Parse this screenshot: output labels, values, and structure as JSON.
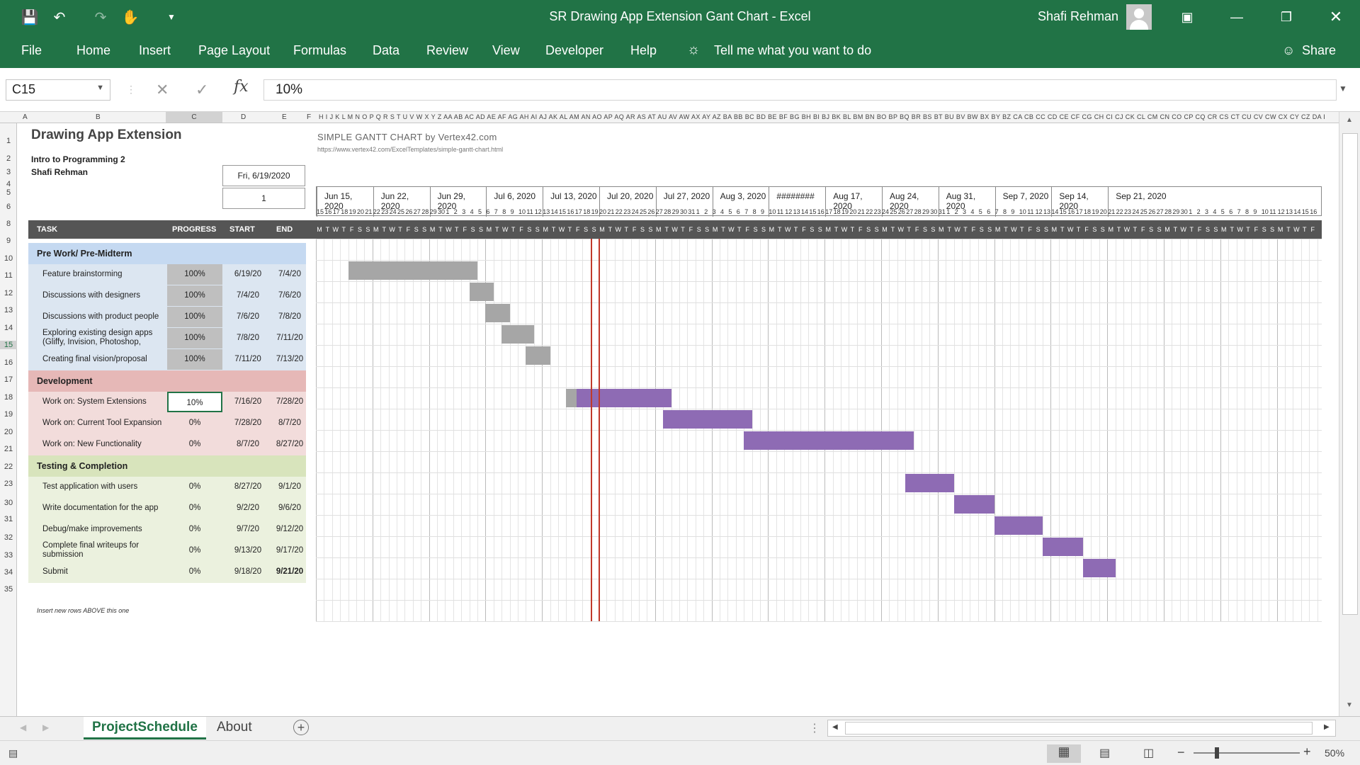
{
  "window": {
    "title": "SR Drawing App Extension Gant Chart  -  Excel",
    "user": "Shafi Rehman",
    "colors": {
      "ribbon": "#217346",
      "complete_bar": "#a6a6a6",
      "task_bar": "#8e6bb4",
      "today_line": "#c0392b"
    }
  },
  "qat": {
    "save_icon": "save-icon",
    "undo_icon": "undo-icon",
    "redo_icon": "redo-icon",
    "touch_icon": "touch-mode-icon",
    "customize_icon": "customize-qat-icon"
  },
  "ribbon": {
    "tabs": [
      "File",
      "Home",
      "Insert",
      "Page Layout",
      "Formulas",
      "Data",
      "Review",
      "View",
      "Developer",
      "Help"
    ],
    "tell_me": "Tell me what you want to do",
    "share": "Share"
  },
  "formula_bar": {
    "name_box": "C15",
    "value": "10%"
  },
  "columns": {
    "a": "A",
    "b": "B",
    "c": "C",
    "d": "D",
    "e": "E",
    "f": "F"
  },
  "rows": [
    "1",
    "2",
    "3",
    "4",
    "5",
    "6",
    "8",
    "9",
    "10",
    "11",
    "12",
    "13",
    "14",
    "15",
    "16",
    "17",
    "18",
    "19",
    "20",
    "21",
    "22",
    "23",
    "30",
    "31",
    "32",
    "33",
    "34",
    "35"
  ],
  "sheet": {
    "title": "Drawing App Extension",
    "subtitle": "Intro to Programming 2",
    "author": "Shafi Rehman",
    "project_start": "Fri, 6/19/2020",
    "display_week": "1",
    "template_title": "SIMPLE GANTT CHART by Vertex42.com",
    "template_url": "https://www.vertex42.com/ExcelTemplates/simple-gantt-chart.html",
    "headers": {
      "task": "TASK",
      "progress": "PROGRESS",
      "start": "START",
      "end": "END"
    },
    "weeks": [
      "Jun 15, 2020",
      "Jun 22, 2020",
      "Jun 29, 2020",
      "Jul 6, 2020",
      "Jul 13, 2020",
      "Jul 20, 2020",
      "Jul 27, 2020",
      "Aug 3, 2020",
      "########",
      "Aug 17, 2020",
      "Aug 24, 2020",
      "Aug 31, 2020",
      "Sep 7, 2020",
      "Sep 14, 2020",
      "Sep 21, 2020"
    ],
    "dow": [
      "M",
      "T",
      "W",
      "T",
      "F",
      "S",
      "S"
    ],
    "insert_note": "Insert new rows ABOVE this one"
  },
  "phases": [
    {
      "label": "Pre Work/ Pre-Midterm",
      "color": "#c5d9f1",
      "row_color": "#dce6f1",
      "tasks": [
        {
          "name": "Feature brainstorming",
          "progress": "100%",
          "start": "6/19/20",
          "end": "7/4/20"
        },
        {
          "name": "Discussions with designers",
          "progress": "100%",
          "start": "7/4/20",
          "end": "7/6/20"
        },
        {
          "name": "Discussions with product people",
          "progress": "100%",
          "start": "7/6/20",
          "end": "7/8/20"
        },
        {
          "name": "Exploring existing design apps (Gliffy, Invision, Photoshop,",
          "progress": "100%",
          "start": "7/8/20",
          "end": "7/11/20"
        },
        {
          "name": "Creating final vision/proposal",
          "progress": "100%",
          "start": "7/11/20",
          "end": "7/13/20"
        }
      ]
    },
    {
      "label": "Development",
      "color": "#e6b8b7",
      "row_color": "#f2dcdb",
      "tasks": [
        {
          "name": "Work on: System Extensions",
          "progress": "10%",
          "start": "7/16/20",
          "end": "7/28/20"
        },
        {
          "name": "Work on: Current Tool Expansion",
          "progress": "0%",
          "start": "7/28/20",
          "end": "8/7/20"
        },
        {
          "name": "Work on:  New Functionality",
          "progress": "0%",
          "start": "8/7/20",
          "end": "8/27/20"
        }
      ]
    },
    {
      "label": "Testing & Completion",
      "color": "#d8e4bc",
      "row_color": "#ebf1de",
      "tasks": [
        {
          "name": "Test application with users",
          "progress": "0%",
          "start": "8/27/20",
          "end": "9/1/20"
        },
        {
          "name": "Write documentation for the app",
          "progress": "0%",
          "start": "9/2/20",
          "end": "9/6/20"
        },
        {
          "name": "Debug/make improvements",
          "progress": "0%",
          "start": "9/7/20",
          "end": "9/12/20"
        },
        {
          "name": "Complete final writeups for submission",
          "progress": "0%",
          "start": "9/13/20",
          "end": "9/17/20"
        },
        {
          "name": "Submit",
          "progress": "0%",
          "start": "9/18/20",
          "end": "9/21/20"
        }
      ]
    }
  ],
  "chart_data": {
    "type": "bar",
    "title": "",
    "timeline_start": "2020-06-15",
    "today": "2020-07-20",
    "bars": [
      {
        "task": "Feature brainstorming",
        "start": "2020-06-19",
        "end": "2020-07-04",
        "progress": 1.0
      },
      {
        "task": "Discussions with designers",
        "start": "2020-07-04",
        "end": "2020-07-06",
        "progress": 1.0
      },
      {
        "task": "Discussions with product people",
        "start": "2020-07-06",
        "end": "2020-07-08",
        "progress": 1.0
      },
      {
        "task": "Exploring existing design apps",
        "start": "2020-07-08",
        "end": "2020-07-11",
        "progress": 1.0
      },
      {
        "task": "Creating final vision/proposal",
        "start": "2020-07-11",
        "end": "2020-07-13",
        "progress": 1.0
      },
      {
        "task": "Work on: System Extensions",
        "start": "2020-07-16",
        "end": "2020-07-28",
        "progress": 0.1
      },
      {
        "task": "Work on: Current Tool Expansion",
        "start": "2020-07-28",
        "end": "2020-08-07",
        "progress": 0.0
      },
      {
        "task": "Work on:  New Functionality",
        "start": "2020-08-07",
        "end": "2020-08-27",
        "progress": 0.0
      },
      {
        "task": "Test application with users",
        "start": "2020-08-27",
        "end": "2020-09-01",
        "progress": 0.0
      },
      {
        "task": "Write documentation for the app",
        "start": "2020-09-02",
        "end": "2020-09-06",
        "progress": 0.0
      },
      {
        "task": "Debug/make improvements",
        "start": "2020-09-07",
        "end": "2020-09-12",
        "progress": 0.0
      },
      {
        "task": "Complete final writeups for submission",
        "start": "2020-09-13",
        "end": "2020-09-17",
        "progress": 0.0
      },
      {
        "task": "Submit",
        "start": "2020-09-18",
        "end": "2020-09-21",
        "progress": 0.0
      }
    ]
  },
  "tabs": {
    "sheets": [
      "ProjectSchedule",
      "About"
    ],
    "add_icon": "add-sheet-icon"
  },
  "status": {
    "zoom": "50%",
    "views": [
      "normal-view-icon",
      "page-layout-icon",
      "page-break-icon"
    ]
  }
}
